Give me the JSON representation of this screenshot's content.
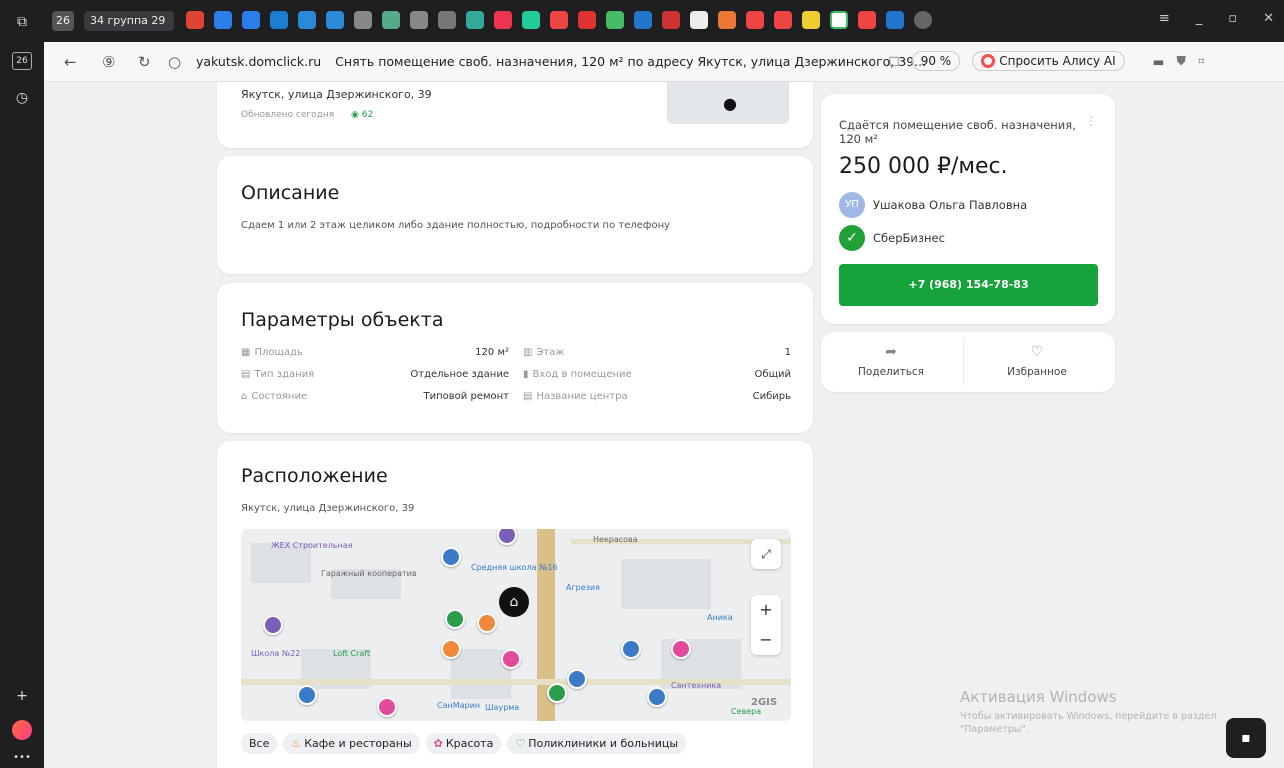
{
  "browser": {
    "tab_count": "26",
    "group_label": "34 группа 29",
    "url_domain": "yakutsk.domclick.ru",
    "page_title": "Снять помещение своб. назначения, 120 м² по адресу Якутск, улица Дзержинского, 39...",
    "zoom": "90 %",
    "alice_label": "Спросить Алису AI",
    "rail_count": "26"
  },
  "header_card": {
    "address": "Якутск, улица Дзержинского, 39",
    "updated": "Обновлено сегодня",
    "views": "62"
  },
  "description": {
    "title": "Описание",
    "text": "Сдаем 1 или 2 этаж целиком либо здание полностью, подробности по телефону"
  },
  "params": {
    "title": "Параметры объекта",
    "left": [
      {
        "label": "Площадь",
        "value": "120 м²"
      },
      {
        "label": "Тип здания",
        "value": "Отдельное здание"
      },
      {
        "label": "Состояние",
        "value": "Типовой ремонт"
      }
    ],
    "right": [
      {
        "label": "Этаж",
        "value": "1"
      },
      {
        "label": "Вход в помещение",
        "value": "Общий"
      },
      {
        "label": "Название центра",
        "value": "Сибирь"
      }
    ]
  },
  "location": {
    "title": "Расположение",
    "address": "Якутск, улица Дзержинского, 39",
    "map_labels": [
      "ЖЕХ Строительная",
      "Гаражный кооператив",
      "Средняя школа №16",
      "Некрасова",
      "Агрезия",
      "Аника",
      "Школа №22",
      "Loft Craft",
      "Сантехника",
      "СанМарин",
      "Шаурма",
      "Севера",
      "2GIS"
    ],
    "map_zoom_in": "+",
    "map_zoom_out": "−",
    "chips": [
      "Все",
      "Кафе и рестораны",
      "Красота",
      "Поликлиники и больницы"
    ]
  },
  "offer": {
    "title": "Сдаётся помещение своб. назначения, 120 м²",
    "price": "250 000 ₽/мес.",
    "agent_initials": "УП",
    "agent_name": "Ушакова Ольга Павловна",
    "company": "СберБизнес",
    "phone": "+7 (968) 154-78-83",
    "share": "Поделиться",
    "favorite": "Избранное"
  },
  "watermark": {
    "title": "Активация Windows",
    "text": "Чтобы активировать Windows, перейдите в раздел \"Параметры\"."
  },
  "colors": {
    "accent_green": "#16a33b",
    "page_bg": "#eef0f2"
  }
}
